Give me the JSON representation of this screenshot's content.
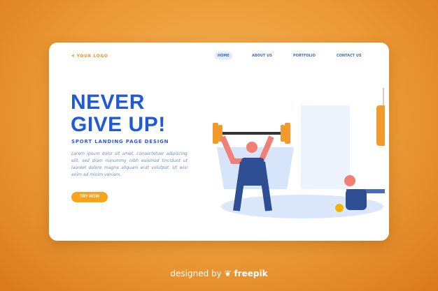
{
  "header": {
    "logo": "YOUR LOGO",
    "nav": [
      {
        "label": "HOME",
        "active": true
      },
      {
        "label": "ABOUT US"
      },
      {
        "label": "PORTFOLIO"
      },
      {
        "label": "CONTACT US"
      }
    ]
  },
  "hero": {
    "title_line1": "NEVER",
    "title_line2": "GIVE UP!",
    "subtitle": "SPORT LANDING PAGE DESIGN",
    "body": "Lorem ipsum dolor sit amet, consectetuer adipiscing elit, sed diam nonummy nibh euismod tincidunt ut laoreet dolore magna aliquam erat volutpat. Ut wisi enim ad minim veniam.",
    "cta": "TRY NOW"
  },
  "footer": {
    "designed_by": "designed by",
    "brand": "freepik"
  },
  "colors": {
    "accent": "#f9a21b",
    "primary": "#1f5ad8",
    "background": "#eb9a35"
  }
}
